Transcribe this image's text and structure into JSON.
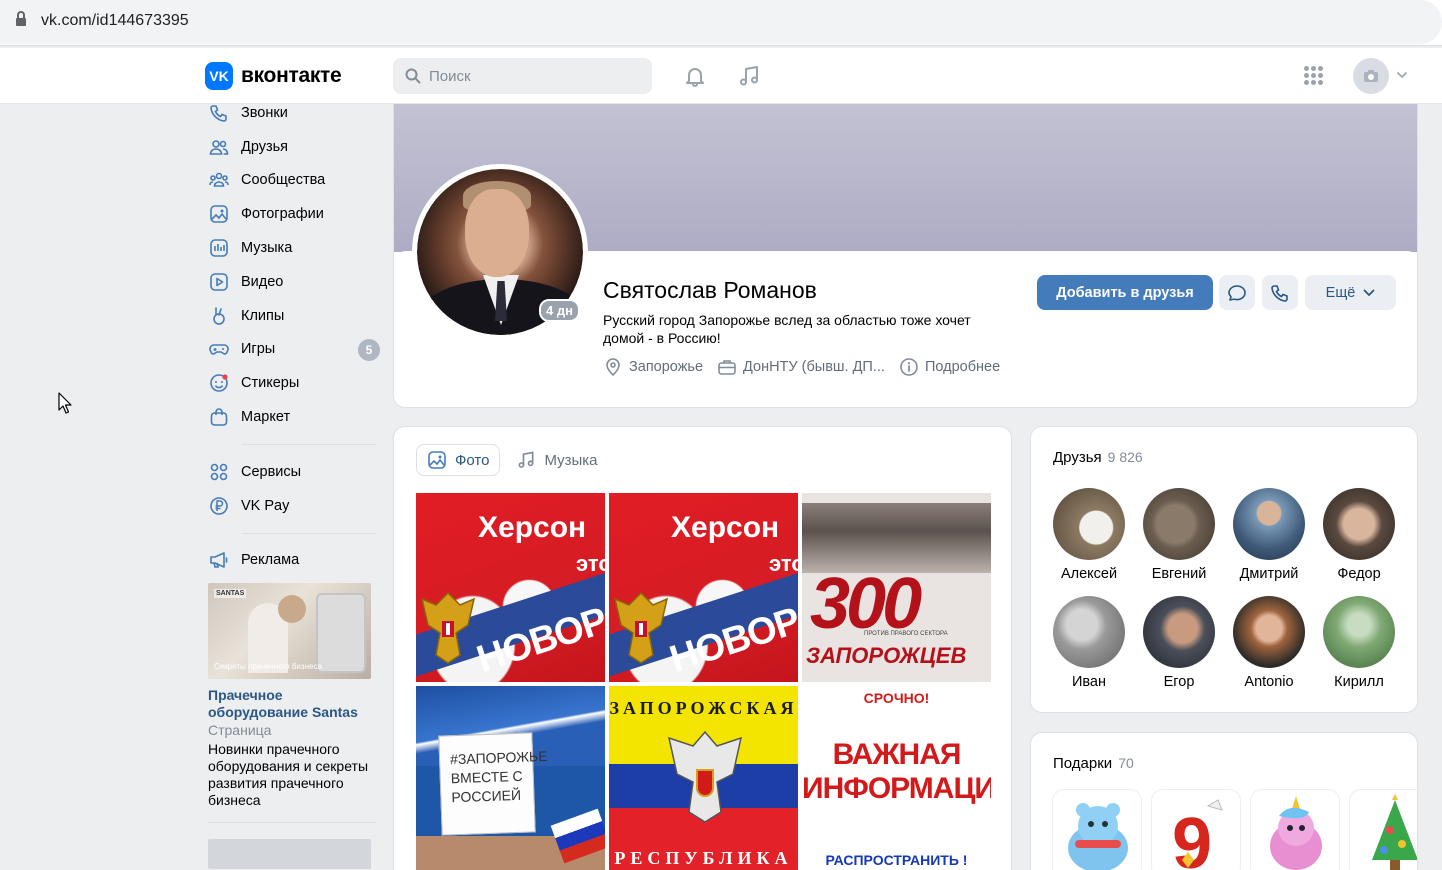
{
  "browser": {
    "url": "vk.com/id144673395"
  },
  "header": {
    "logo_text": "вконтакте",
    "logo_badge": "VK",
    "search_placeholder": "Поиск",
    "accent": "#0077ff"
  },
  "sidebar": {
    "items": [
      {
        "label": "Звонки",
        "icon": "phone-icon"
      },
      {
        "label": "Друзья",
        "icon": "friends-icon"
      },
      {
        "label": "Сообщества",
        "icon": "communities-icon"
      },
      {
        "label": "Фотографии",
        "icon": "photos-icon"
      },
      {
        "label": "Музыка",
        "icon": "music-icon"
      },
      {
        "label": "Видео",
        "icon": "video-icon"
      },
      {
        "label": "Клипы",
        "icon": "clips-icon"
      },
      {
        "label": "Игры",
        "icon": "games-icon",
        "badge": "5"
      },
      {
        "label": "Стикеры",
        "icon": "stickers-icon"
      },
      {
        "label": "Маркет",
        "icon": "market-icon"
      }
    ],
    "items2": [
      {
        "label": "Сервисы",
        "icon": "services-icon"
      },
      {
        "label": "VK Pay",
        "icon": "vkpay-icon"
      }
    ],
    "items3": [
      {
        "label": "Реклама",
        "icon": "megaphone-icon"
      }
    ],
    "ad": {
      "image_brand": "SANTAS",
      "image_caption": "Секреты прачечного бизнеса",
      "title": "Прачечное оборудование Santas",
      "type": "Страница",
      "description": "Новинки прачечного оборудования и секреты развития прачечного бизнеса"
    }
  },
  "profile": {
    "name": "Святослав Романов",
    "status": "Русский город Запорожье вслед за областью тоже хочет домой - в Россию!",
    "online": "4 дн",
    "city": "Запорожье",
    "education": "ДонНТУ (бывш. ДП...",
    "more_info": "Подробнее",
    "add_friend": "Добавить в друзья",
    "more": "Ещё",
    "cover_color": "#b8b6cc"
  },
  "media": {
    "tabs": [
      {
        "label": "Фото",
        "active": true
      },
      {
        "label": "Музыка",
        "active": false
      }
    ],
    "photos": {
      "herson_title": "Херсон",
      "herson_eto": "это",
      "herson_novo": "НОВОРОС",
      "p300_num": "300",
      "p300_sub": "ЗАПОРОЖЦЕВ",
      "p300_tiny": "ПРОТИВ ПРАВОГО СЕКТОРА",
      "rally_sign": "#ЗАПОРОЖЬЕ ВМЕСТЕ С РОССИЕЙ",
      "zap_top": "ЗАПОРОЖСКАЯ",
      "zap_bottom": "РЕСПУБЛИКА",
      "info_t1": "СРОЧНО!",
      "info_t2": "ВАЖНАЯ ИНФОРМАЦИЯ",
      "info_t3": "РАСПРОСТРАНИТЬ !"
    }
  },
  "friends": {
    "title": "Друзья",
    "count": "9 826",
    "list": [
      {
        "name": "Алексей",
        "color": "#8d7a63"
      },
      {
        "name": "Евгений",
        "color": "#6b5e50"
      },
      {
        "name": "Дмитрий",
        "color": "#3f5a78"
      },
      {
        "name": "Федор",
        "color": "#7a6a60"
      },
      {
        "name": "Иван",
        "color": "#9a9a9a"
      },
      {
        "name": "Егор",
        "color": "#4a4f5a"
      },
      {
        "name": "Antonio",
        "color": "#6a5240"
      },
      {
        "name": "Кирилл",
        "color": "#5f8a5a"
      }
    ]
  },
  "gifts": {
    "title": "Подарки",
    "count": "70",
    "items": [
      "bear-gift",
      "nine-gift",
      "unicorn-gift",
      "tree-gift"
    ]
  }
}
